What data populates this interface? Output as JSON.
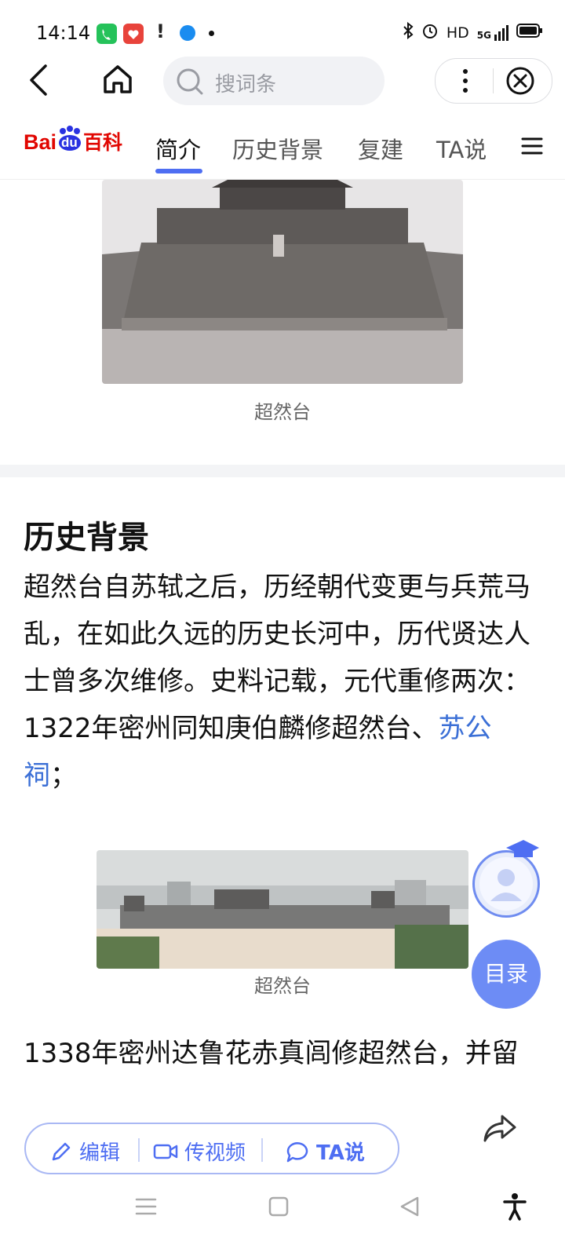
{
  "status_bar": {
    "time": "14:14",
    "hd": "HD",
    "network": "5G"
  },
  "top_bar": {
    "search_placeholder": "搜词条"
  },
  "tabs": {
    "logo_text": "Bai",
    "logo_du": "du",
    "logo_baike": "百科",
    "items": [
      "简介",
      "历史背景",
      "复建",
      "TA说"
    ]
  },
  "content": {
    "caption_1": "超然台",
    "section_title": "历史背景",
    "para_1": "超然台自苏轼之后，历经朝代变更与兵荒马乱，在如此久远的历史长河中，历代贤达人士曾多次维修。史料记载，元代重修两次：1322年密州同知庚伯麟修超然台、",
    "para_1_link": "苏公祠",
    "para_1_end": "；",
    "caption_2": "超然台",
    "para_2": "1338年密州达鲁花赤真闾修超然台，并留"
  },
  "floating": {
    "toc_label": "目录"
  },
  "bottom_bar": {
    "edit_label": "编辑",
    "video_label": "传视频",
    "ta_label": "TA说"
  },
  "colors": {
    "accent": "#4e6ef2",
    "link": "#3b6fd6",
    "logo_red": "#e10601",
    "logo_blue": "#2932e1"
  }
}
